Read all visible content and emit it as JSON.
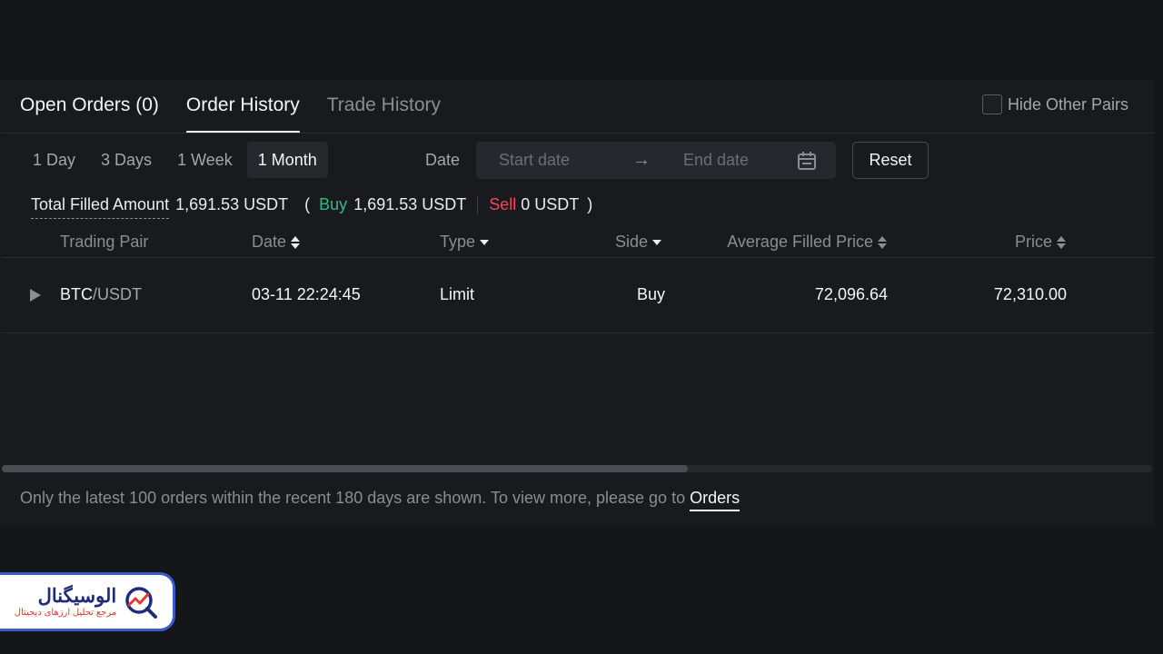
{
  "tabs": [
    {
      "label": "Open Orders (0)",
      "active": false
    },
    {
      "label": "Order History",
      "active": true
    },
    {
      "label": "Trade History",
      "active": false
    }
  ],
  "hide_other_pairs": {
    "label": "Hide Other Pairs",
    "checked": false
  },
  "ranges": [
    "1 Day",
    "3 Days",
    "1 Week",
    "1 Month"
  ],
  "active_range": "1 Month",
  "date_filter": {
    "label": "Date",
    "start_placeholder": "Start date",
    "arrow": "→",
    "end_placeholder": "End date"
  },
  "reset_label": "Reset",
  "summary": {
    "label": "Total Filled Amount",
    "total": "1,691.53 USDT",
    "open_paren": "(",
    "buy_label": "Buy",
    "buy_value": "1,691.53 USDT",
    "sell_label": "Sell",
    "sell_value": "0 USDT",
    "close_paren": ")"
  },
  "columns": {
    "pair": "Trading Pair",
    "date": "Date",
    "type": "Type",
    "side": "Side",
    "avg_price": "Average Filled Price",
    "price": "Price"
  },
  "orders": [
    {
      "base": "BTC",
      "quote": "/USDT",
      "date": "03-11 22:24:45",
      "type": "Limit",
      "side": "Buy",
      "avg_price": "72,096.64",
      "price": "72,310.00"
    }
  ],
  "footer": {
    "note": "Only the latest 100 orders within the recent 180 days are shown. To view more, please go to",
    "link": "Orders"
  },
  "logo": {
    "title": "الوسیگنال",
    "subtitle": "مرجع تحلیل ارزهای دیجیتال"
  },
  "colors": {
    "background": "#151619",
    "panel": "#181a1e",
    "buy": "#2ebd85",
    "sell": "#f6465d",
    "logo_navy": "#1d2b7a",
    "logo_red": "#e0392e"
  }
}
